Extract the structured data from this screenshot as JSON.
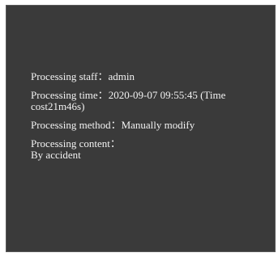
{
  "record": {
    "staff_label": "Processing staff：",
    "staff_value": "admin",
    "time_label": "Processing time：",
    "time_value": "2020-09-07 09:55:45 (Time cost21m46s)",
    "method_label": "Processing method：",
    "method_value": "Manually modify",
    "content_label": "Processing content：",
    "content_value": "By accident"
  }
}
